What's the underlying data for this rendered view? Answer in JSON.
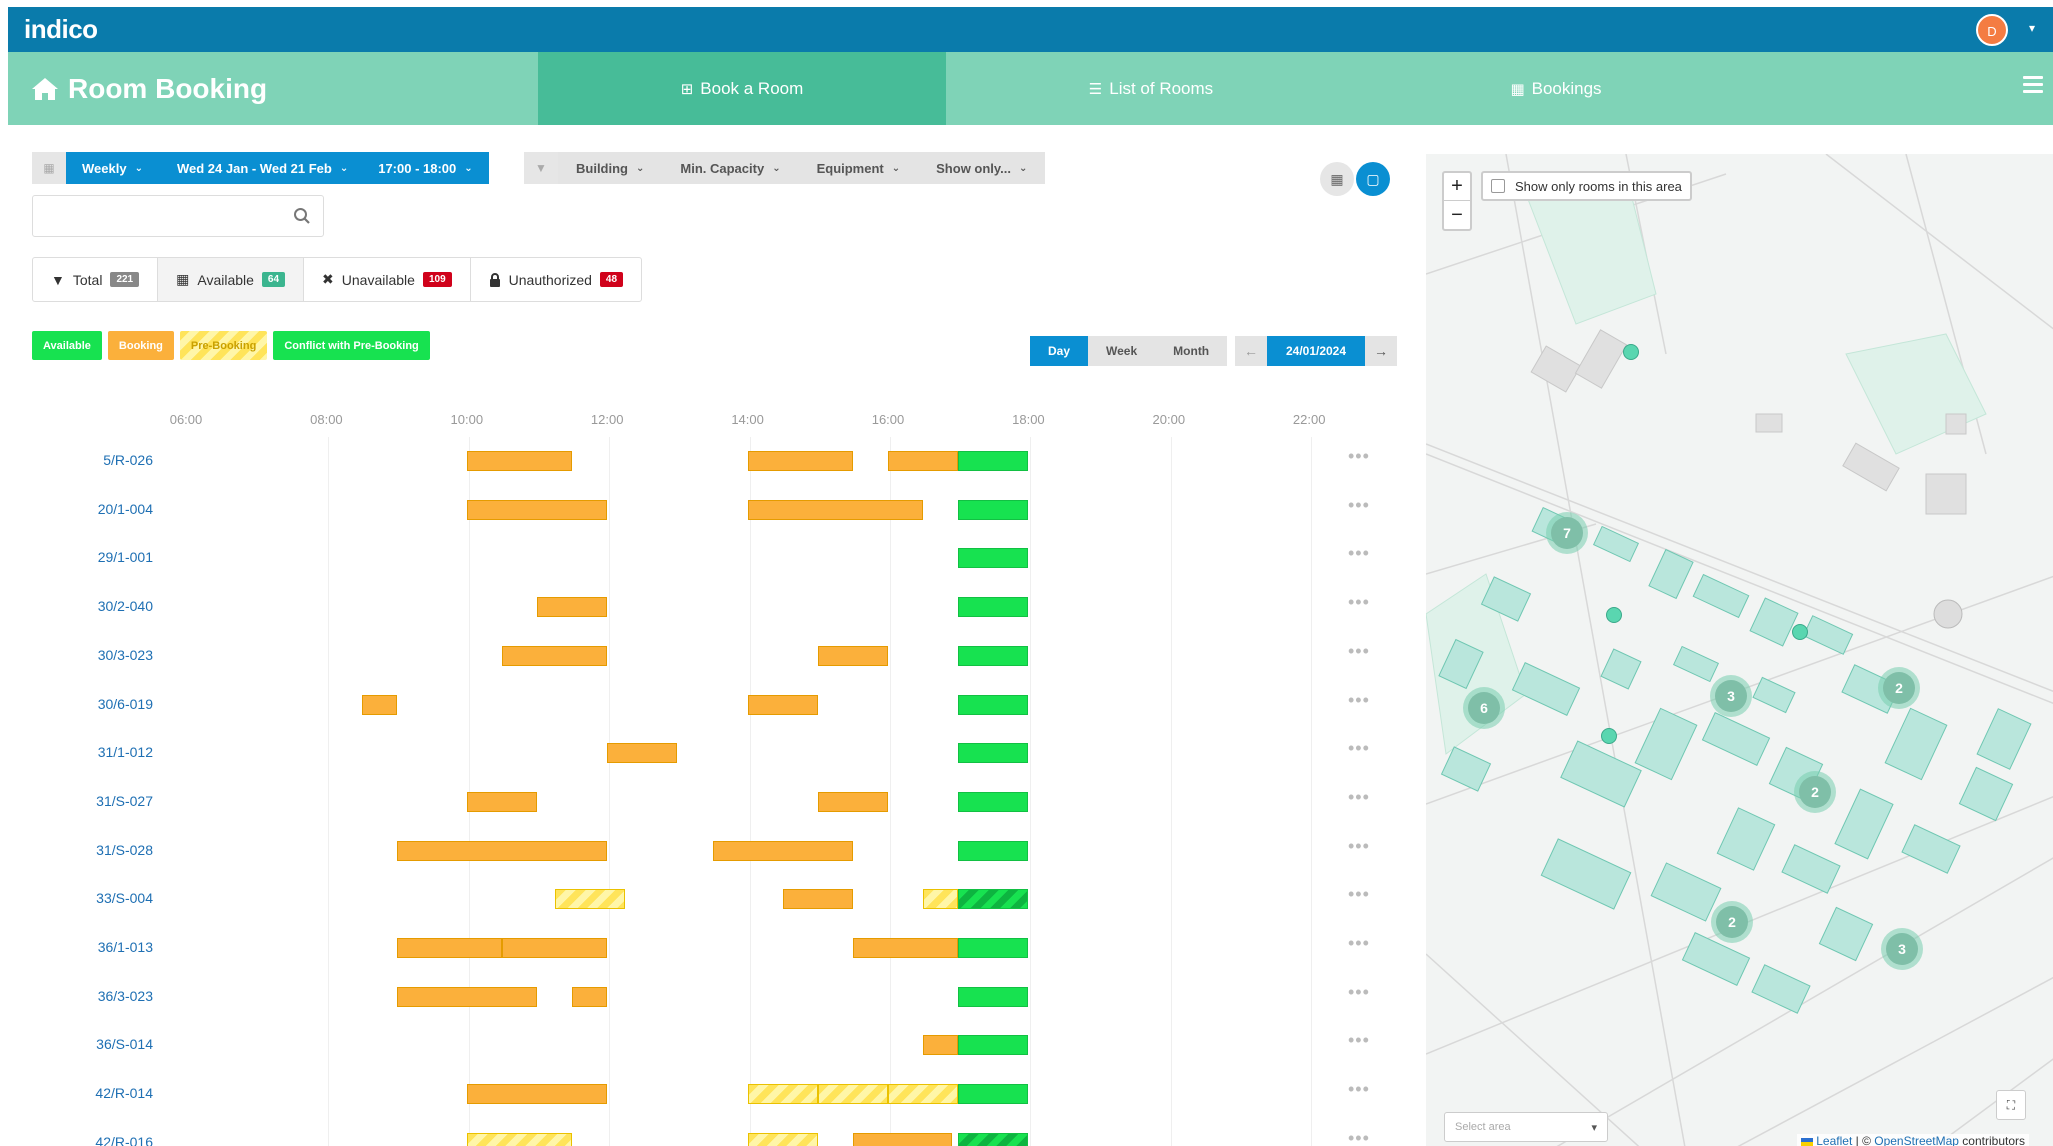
{
  "app": {
    "logo": "indico",
    "avatar_initial": "D"
  },
  "header": {
    "title": "Room Booking",
    "tabs": [
      {
        "label": "Book a Room",
        "icon": "plus-square-icon",
        "active": true
      },
      {
        "label": "List of Rooms",
        "icon": "list-icon",
        "active": false
      },
      {
        "label": "Bookings",
        "icon": "calendar-icon",
        "active": false
      }
    ]
  },
  "filters": {
    "recurrence": "Weekly",
    "dates": "Wed 24 Jan - Wed 21 Feb",
    "time": "17:00 - 18:00",
    "building": "Building",
    "capacity": "Min. Capacity",
    "equipment": "Equipment",
    "show_only": "Show only..."
  },
  "search": {
    "value": "",
    "placeholder": ""
  },
  "stats": {
    "total_label": "Total",
    "total_count": "221",
    "available_label": "Available",
    "available_count": "64",
    "unavailable_label": "Unavailable",
    "unavailable_count": "109",
    "unauthorized_label": "Unauthorized",
    "unauthorized_count": "48"
  },
  "legend": {
    "available": "Available",
    "booking": "Booking",
    "pre_booking": "Pre-Booking",
    "conflict": "Conflict with Pre-Booking"
  },
  "view": {
    "day": "Day",
    "week": "Week",
    "month": "Month",
    "active": "Day",
    "date": "24/01/2024"
  },
  "colors": {
    "top_bar": "#0a7bab",
    "header": "#7fd3b7",
    "active_tab": "#47bc98",
    "primary": "#0a8fd2",
    "booking": "#fbb03b",
    "available": "#17e250",
    "pre_booking": "#ffe45a",
    "badge_red": "#d0021b",
    "badge_green": "#3bb58f",
    "badge_grey": "#888888"
  },
  "timeline": {
    "hours": [
      "06:00",
      "08:00",
      "10:00",
      "12:00",
      "14:00",
      "16:00",
      "18:00",
      "20:00",
      "22:00"
    ],
    "rows": [
      {
        "room": "5/R-026",
        "slots": [
          [
            "booking",
            "10:00",
            "11:30"
          ],
          [
            "booking",
            "14:00",
            "15:30"
          ],
          [
            "booking",
            "16:00",
            "17:00"
          ],
          [
            "available",
            "17:00",
            "18:00"
          ]
        ]
      },
      {
        "room": "20/1-004",
        "slots": [
          [
            "booking",
            "10:00",
            "12:00"
          ],
          [
            "booking",
            "14:00",
            "16:30"
          ],
          [
            "available",
            "17:00",
            "18:00"
          ]
        ]
      },
      {
        "room": "29/1-001",
        "slots": [
          [
            "available",
            "17:00",
            "18:00"
          ]
        ]
      },
      {
        "room": "30/2-040",
        "slots": [
          [
            "booking",
            "11:00",
            "12:00"
          ],
          [
            "available",
            "17:00",
            "18:00"
          ]
        ]
      },
      {
        "room": "30/3-023",
        "slots": [
          [
            "booking",
            "10:30",
            "12:00"
          ],
          [
            "booking",
            "15:00",
            "16:00"
          ],
          [
            "available",
            "17:00",
            "18:00"
          ]
        ]
      },
      {
        "room": "30/6-019",
        "slots": [
          [
            "booking",
            "08:30",
            "09:00"
          ],
          [
            "booking",
            "14:00",
            "15:00"
          ],
          [
            "available",
            "17:00",
            "18:00"
          ]
        ]
      },
      {
        "room": "31/1-012",
        "slots": [
          [
            "booking",
            "12:00",
            "13:00"
          ],
          [
            "available",
            "17:00",
            "18:00"
          ]
        ]
      },
      {
        "room": "31/S-027",
        "slots": [
          [
            "booking",
            "10:00",
            "11:00"
          ],
          [
            "booking",
            "15:00",
            "16:00"
          ],
          [
            "available",
            "17:00",
            "18:00"
          ]
        ]
      },
      {
        "room": "31/S-028",
        "slots": [
          [
            "booking",
            "09:00",
            "12:00"
          ],
          [
            "booking",
            "13:30",
            "15:30"
          ],
          [
            "available",
            "17:00",
            "18:00"
          ]
        ]
      },
      {
        "room": "33/S-004",
        "slots": [
          [
            "pre",
            "11:15",
            "12:15"
          ],
          [
            "booking",
            "14:30",
            "15:30"
          ],
          [
            "pre",
            "16:30",
            "17:00"
          ],
          [
            "conflict",
            "17:00",
            "18:00"
          ]
        ]
      },
      {
        "room": "36/1-013",
        "slots": [
          [
            "booking",
            "09:00",
            "10:30"
          ],
          [
            "booking",
            "10:30",
            "12:00"
          ],
          [
            "booking",
            "15:30",
            "17:00"
          ],
          [
            "available",
            "17:00",
            "18:00"
          ]
        ]
      },
      {
        "room": "36/3-023",
        "slots": [
          [
            "booking",
            "09:00",
            "11:00"
          ],
          [
            "booking",
            "11:30",
            "12:00"
          ],
          [
            "available",
            "17:00",
            "18:00"
          ]
        ]
      },
      {
        "room": "36/S-014",
        "slots": [
          [
            "booking",
            "16:30",
            "17:00"
          ],
          [
            "available",
            "17:00",
            "18:00"
          ]
        ]
      },
      {
        "room": "42/R-014",
        "slots": [
          [
            "booking",
            "10:00",
            "12:00"
          ],
          [
            "pre",
            "14:00",
            "15:00"
          ],
          [
            "pre",
            "15:00",
            "16:00"
          ],
          [
            "pre",
            "16:00",
            "17:00"
          ],
          [
            "available",
            "17:00",
            "18:00"
          ]
        ]
      },
      {
        "room": "42/R-016",
        "slots": [
          [
            "pre",
            "10:00",
            "11:30"
          ],
          [
            "pre",
            "14:00",
            "15:00"
          ],
          [
            "booking",
            "15:30",
            "16:55"
          ],
          [
            "conflict",
            "17:00",
            "18:00"
          ]
        ]
      }
    ]
  },
  "map": {
    "filter_label": "Show only rooms in this area",
    "zoom_in": "+",
    "zoom_out": "−",
    "select_area": "Select area",
    "fullscreen": "⛶",
    "clusters": [
      "7",
      "6",
      "3",
      "2",
      "2",
      "2",
      "3"
    ],
    "attribution_leaflet": "Leaflet",
    "attribution_sep": " | © ",
    "attribution_osm": "OpenStreetMap",
    "attribution_tail": " contributors"
  }
}
